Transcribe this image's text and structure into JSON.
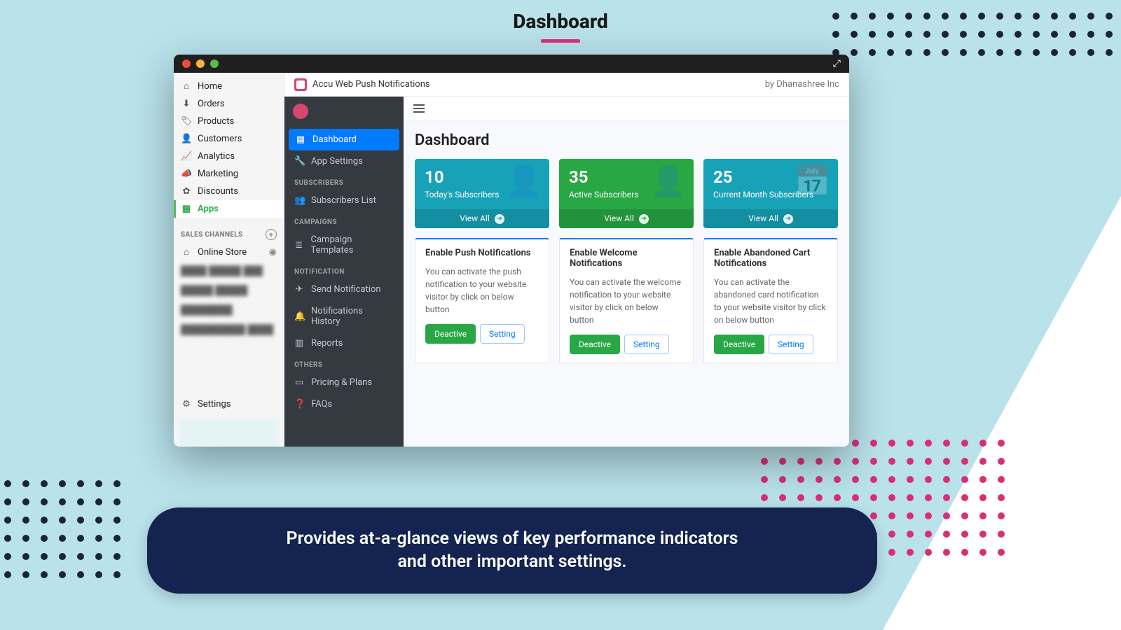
{
  "hero": {
    "title": "Dashboard"
  },
  "banner": {
    "line1": "Provides at-a-glance views of key performance indicators",
    "line2": "and other important settings."
  },
  "app_header": {
    "title": "Accu Web Push Notifications",
    "by": "by Dhanashree Inc"
  },
  "shopify_nav": {
    "items": [
      {
        "glyph": "⌂",
        "label": "Home"
      },
      {
        "glyph": "⬇",
        "label": "Orders"
      },
      {
        "glyph": "🏷",
        "label": "Products"
      },
      {
        "glyph": "👤",
        "label": "Customers"
      },
      {
        "glyph": "📈",
        "label": "Analytics"
      },
      {
        "glyph": "📣",
        "label": "Marketing"
      },
      {
        "glyph": "✿",
        "label": "Discounts"
      },
      {
        "glyph": "▦",
        "label": "Apps"
      }
    ],
    "channels_header": "SALES CHANNELS",
    "online_store": "Online Store",
    "settings": "Settings"
  },
  "dark_nav": {
    "dashboard": "Dashboard",
    "app_settings": "App Settings",
    "section_subscribers": "SUBSCRIBERS",
    "subscribers_list": "Subscribers List",
    "section_campaigns": "CAMPAIGNS",
    "campaign_templates": "Campaign Templates",
    "section_notification": "NOTIFICATION",
    "send_notification": "Send Notification",
    "notifications_history": "Notifications History",
    "reports": "Reports",
    "section_others": "OTHERS",
    "pricing": "Pricing & Plans",
    "faqs": "FAQs"
  },
  "main": {
    "title": "Dashboard",
    "stats": [
      {
        "value": "10",
        "label": "Today's Subscribers",
        "view_all": "View All",
        "tone": "teal"
      },
      {
        "value": "35",
        "label": "Active Subscribers",
        "view_all": "View All",
        "tone": "green"
      },
      {
        "value": "25",
        "label": "Current Month Subscribers",
        "view_all": "View All",
        "tone": "teal"
      }
    ],
    "cards": [
      {
        "title": "Enable Push Notifications",
        "desc": "You can activate the push notification to your website visitor by click on below button",
        "deactive": "Deactive",
        "setting": "Setting"
      },
      {
        "title": "Enable Welcome Notifications",
        "desc": "You can activate the welcome notification to your website visitor by click on below button",
        "deactive": "Deactive",
        "setting": "Setting"
      },
      {
        "title": "Enable Abandoned Cart Notifications",
        "desc": "You can activate the abandoned card notification to your website visitor by click on below button",
        "deactive": "Deactive",
        "setting": "Setting"
      }
    ]
  }
}
